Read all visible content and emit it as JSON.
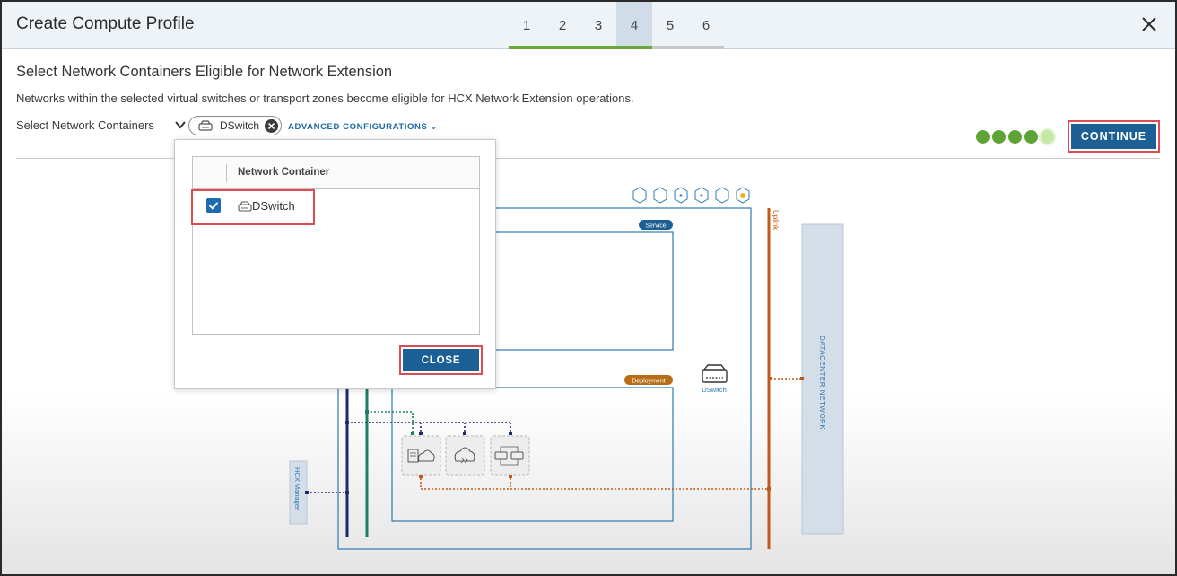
{
  "dialog": {
    "title": "Create Compute Profile",
    "steps": [
      {
        "label": "1",
        "state": "done"
      },
      {
        "label": "2",
        "state": "done"
      },
      {
        "label": "3",
        "state": "done"
      },
      {
        "label": "4",
        "state": "active"
      },
      {
        "label": "5",
        "state": "pending"
      },
      {
        "label": "6",
        "state": "pending"
      }
    ],
    "close_icon": "close-icon"
  },
  "section": {
    "title": "Select Network Containers Eligible for Network Extension",
    "description": "Networks within the selected virtual switches or transport zones become eligible for HCX Network Extension operations.",
    "select_label": "Select Network Containers",
    "selected_chip": "DSwitch",
    "advanced_link": "ADVANCED CONFIGURATIONS",
    "continue_label": "CONTINUE"
  },
  "popup": {
    "column_header": "Network Container",
    "rows": [
      {
        "label": "DSwitch",
        "checked": true
      }
    ],
    "close_label": "CLOSE"
  },
  "diagram": {
    "service_badge": "Service",
    "deployment_badge": "Deployment",
    "uplink_label": "Uplink",
    "datacenter_label": "DATACENTER NETWORK",
    "hcx_manager_label": "HCX Manager",
    "dswitch_label": "DSwitch"
  },
  "colors": {
    "header_bg": "#eef3f8",
    "primary_button": "#1c5f95",
    "step_done": "#6aa83c",
    "highlight_border": "#e04a54",
    "diagram_blue": "#2e7ab0",
    "uplink_orange": "#c05a16",
    "mgmt_navy": "#1b2a6b",
    "vmotion_teal": "#1c7e68"
  }
}
